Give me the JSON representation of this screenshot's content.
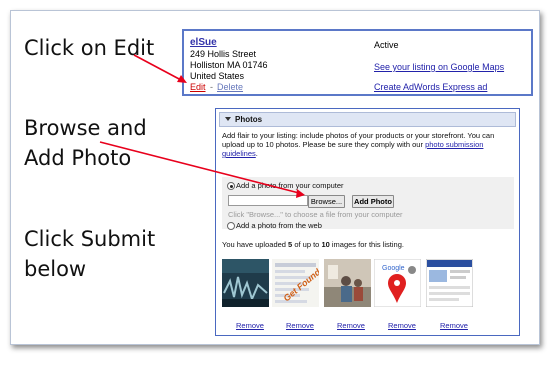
{
  "instructions": {
    "step1": "Click on Edit",
    "step2_line1": "Browse and",
    "step2_line2": "Add Photo",
    "step3_line1": "Click Submit",
    "step3_line2": "below"
  },
  "listing": {
    "name": "elSue",
    "street": "249 Hollis Street",
    "city": "Holliston MA 01746",
    "country": "United States",
    "edit_link": "Edit",
    "separator": "-",
    "delete_link": "Delete",
    "status": "Active",
    "maps_link": "See your listing on Google Maps",
    "adwords_link": "Create AdWords Express ad"
  },
  "photos": {
    "section_title": "Photos",
    "description": "Add flair to your listing: include photos of your products or your storefront. You can upload up to 10 photos. Please be sure they comply with our",
    "guidelines_link": "photo submission guidelines",
    "option_computer": "Add a photo from your computer",
    "browse_button": "Browse...",
    "add_photo_button": "Add Photo",
    "hint": "Click \"Browse...\" to choose a file from your computer",
    "option_web": "Add a photo from the web",
    "count_prefix": "You have uploaded",
    "uploaded": "5",
    "count_mid": "of up to",
    "max": "10",
    "count_suffix": "images for this listing.",
    "remove_labels": [
      "Remove",
      "Remove",
      "Remove",
      "Remove",
      "Remove"
    ],
    "thumb_text_2": "Get Found",
    "thumb_text_4": "Google"
  },
  "colors": {
    "arrow": "#e8001c",
    "listing_border": "#5b78c8",
    "link": "#2222aa",
    "edit": "#cc0000"
  }
}
